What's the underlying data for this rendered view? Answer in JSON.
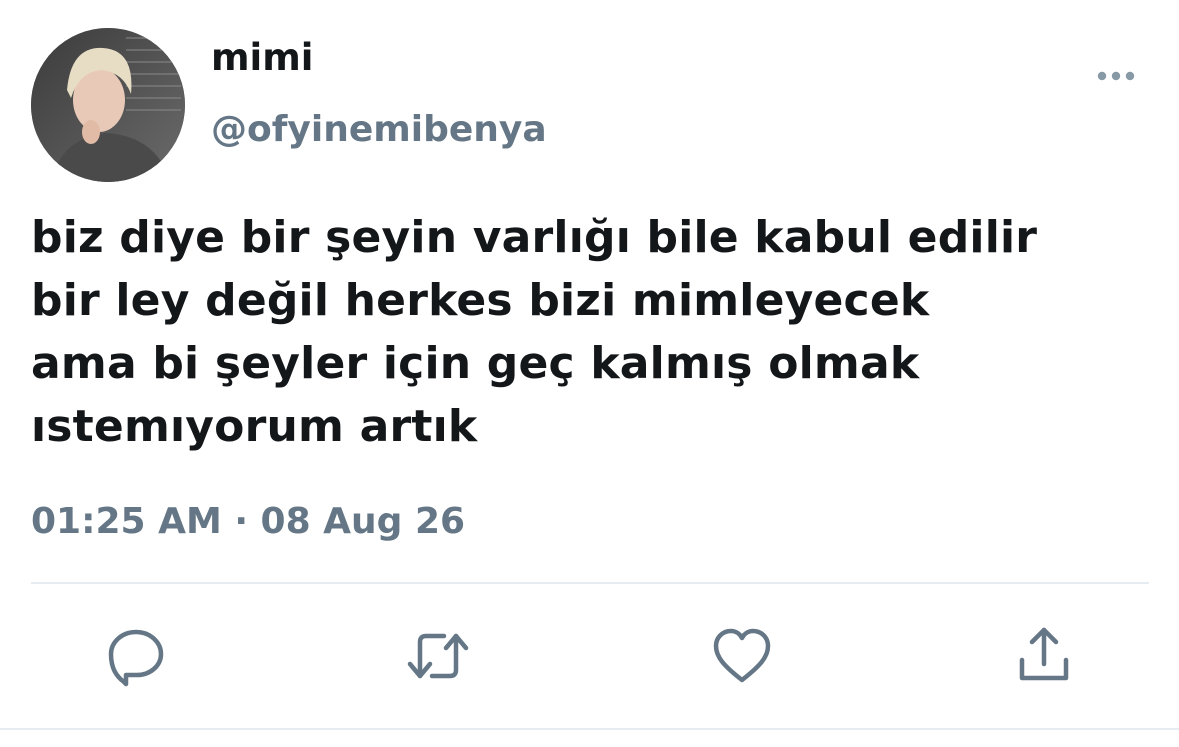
{
  "user": {
    "display_name": "mimi",
    "handle": "@ofyinemibenya",
    "avatar_icon": "profile-photo"
  },
  "tweet": {
    "lines": [
      "biz diye bir şeyin varlığı bile kabul edilir",
      "bir ley değil herkes bizi mimleyecek",
      "ama bi şeyler için geç kalmış olmak",
      "ıstemıyorum artık"
    ],
    "timestamp": "01:25 AM · 08 Aug 26"
  },
  "actions": [
    {
      "name": "reply",
      "icon": "speech-bubble-icon"
    },
    {
      "name": "retweet",
      "icon": "retweet-arrows-icon"
    },
    {
      "name": "like",
      "icon": "heart-icon"
    },
    {
      "name": "share",
      "icon": "share-upload-icon"
    }
  ],
  "colors": {
    "text": "#14171a",
    "secondary": "#657786",
    "divider": "#e6ecf0"
  }
}
